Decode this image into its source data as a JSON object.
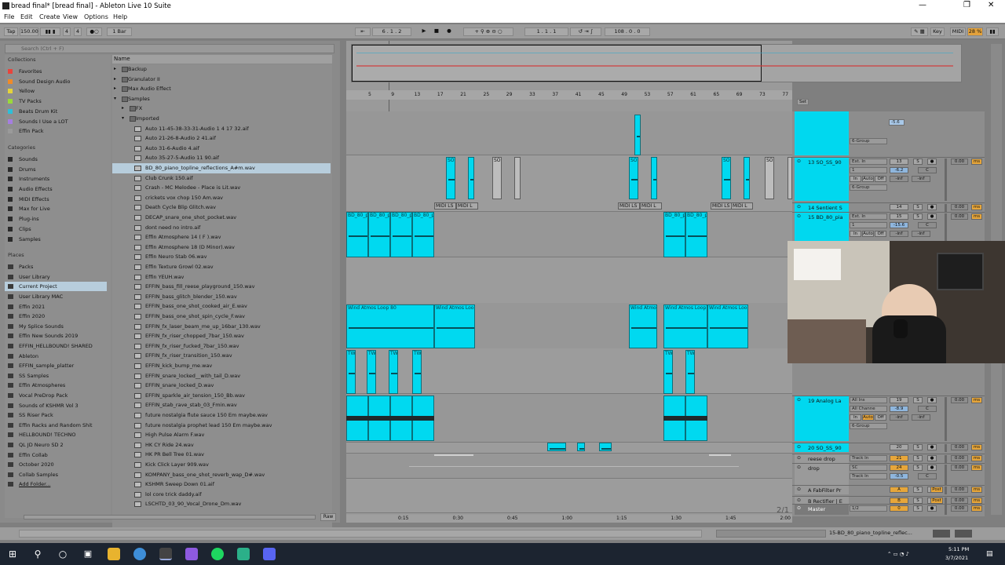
{
  "window": {
    "title": "bread final*  [bread final] - Ableton Live 10 Suite",
    "min": "—",
    "restore": "❐",
    "close": "✕"
  },
  "menu": [
    "File",
    "Edit",
    "Create",
    "View",
    "Options",
    "Help"
  ],
  "transport": {
    "tap": "Tap",
    "bpm": "150.00",
    "sig_num": "4",
    "sig_den": "4",
    "quant": "1 Bar",
    "position": "6 .  1 .  2",
    "loop_start": "1 .  1 .  1",
    "loop_len": "108 .  0 .  0",
    "key": "Key",
    "midi": "MIDI",
    "cpu": "28 %"
  },
  "browser": {
    "search_placeholder": "Search (Ctrl + F)",
    "collections_header": "Collections",
    "collections": [
      {
        "label": "Favorites",
        "color": "#e8453c"
      },
      {
        "label": "Sound Design Audio",
        "color": "#f08a28"
      },
      {
        "label": "Yellow",
        "color": "#e4d23b"
      },
      {
        "label": "TV Packs",
        "color": "#9ad93a"
      },
      {
        "label": "Beats Drum Kit",
        "color": "#2dbfd8"
      },
      {
        "label": "Sounds I Use a LOT",
        "color": "#a57ee0"
      },
      {
        "label": "Effin Pack",
        "color": "#9a9a9a"
      }
    ],
    "categories_header": "Categories",
    "categories": [
      "Sounds",
      "Drums",
      "Instruments",
      "Audio Effects",
      "MIDI Effects",
      "Max for Live",
      "Plug-ins",
      "Clips",
      "Samples"
    ],
    "places_header": "Places",
    "places": [
      "Packs",
      "User Library",
      "Current Project",
      "User Library MAC",
      "Effin 2021",
      "Effin 2020",
      "My Splice Sounds",
      "Effin New Sounds 2019",
      "EFFIN_HELLBOUND! SHARED",
      "Ableton",
      "EFFIN_sample_platter",
      "SS Samples",
      "Effin Atmospheres",
      "Vocal PreDrop Pack",
      "Sounds of KSHMR Vol 3",
      "SS Riser Pack",
      "Effin Racks and Random Shit",
      "HELLBOUND! TECHNO",
      "QL JD Neuro SD 2",
      "Effin Collab",
      "October 2020",
      "Collab Samples",
      "Add Folder..."
    ],
    "name_header": "Name",
    "files": [
      "Backup",
      "Granulator II",
      "Max Audio Effect",
      "Samples",
      "FX",
      "Imported",
      "Auto 11-45-38-33-31-Audio 1 4 17 32.aif",
      "Auto 21-26-8-Audio 2 41.aif",
      "Auto 31-6-Audio 4.aif",
      "Auto 35-27-5-Audio 11 90.aif",
      "BD_80_piano_topline_reflections_A#m.wav",
      "Club Crunk 150.aif",
      "Crash - MC Melodee - Place is Lit.wav",
      "crickets vox chop 150 Am.wav",
      "Death Cycle Blip Glitch.wav",
      "DECAP_snare_one_shot_pocket.wav",
      "dont need no intro.aif",
      "Effin Atmosphere 14 ( F ).wav",
      "Effin Atmosphere 18 (D Minor).wav",
      "Effin Neuro Stab 06.wav",
      "Effin Texture Growl 02.wav",
      "Effin YEUH.wav",
      "EFFIN_bass_fill_reese_playground_150.wav",
      "EFFIN_bass_glitch_blender_150.wav",
      "EFFIN_bass_one_shot_cooked_air_E.wav",
      "EFFIN_bass_one_shot_spin_cycle_F.wav",
      "EFFIN_fx_laser_beam_me_up_16bar_130.wav",
      "EFFIN_fx_riser_chopped_7bar_150.wav",
      "EFFIN_fx_riser_fucked_7bar_150.wav",
      "EFFIN_fx_riser_transition_150.wav",
      "EFFIN_kick_bump_me.wav",
      "EFFIN_snare_locked__with_tail_D.wav",
      "EFFIN_snare_locked_D.wav",
      "EFFIN_sparkle_air_tension_150_Bb.wav",
      "EFFIN_stab_rave_stab_03_Fmin.wav",
      "future nostalgia flute sauce 150 Em maybe.wav",
      "future nostalgia prophet lead 150 Em maybe.wav",
      "High Pulse Alarm F.wav",
      "HK CY Ride 24.wav",
      "HK PR Bell Tree 01.wav",
      "Kick Click Layer 909.wav",
      "KOMPANY_bass_one_shot_reverb_wap_D#.wav",
      "KSHMR Sweep Down 01.aif",
      "lol core trick daddy.aif",
      "LSCHTD_03_90_Vocal_Drone_Dm.wav"
    ],
    "raw": "Raw"
  },
  "ruler": [
    "5",
    "9",
    "13",
    "17",
    "21",
    "25",
    "29",
    "33",
    "37",
    "41",
    "45",
    "49",
    "53",
    "57",
    "61",
    "65",
    "69",
    "73",
    "77"
  ],
  "timeline": [
    "0:15",
    "0:30",
    "0:45",
    "1:00",
    "1:15",
    "1:30",
    "1:45",
    "2:00"
  ],
  "set_label": "Set",
  "clips": {
    "so": "SO",
    "bd": "BD_80_p",
    "wind": "Wind Atmos Loop 80",
    "wind2": "Wind Atmos Loo",
    "wind3": "Wind Atmos",
    "wind4": "Wind Atmos Loop",
    "wind5": "Wind Atmos Loo",
    "midi": "MIDI LS",
    "midi2": "MIDI L",
    "tw": "TWI"
  },
  "mixer": {
    "rows": [
      {
        "name": "13 SO_SS_90",
        "input": "Ext. In",
        "chan": "1",
        "mon1": "In",
        "mon2": "Auto",
        "mon3": "Off",
        "out": "6-Group",
        "num": "13",
        "vol": "-6.2",
        "pan": "C",
        "sends": "-inf",
        "dB": "0.00",
        "ms": "ms"
      },
      {
        "name": "14 Sentient S",
        "num": "14",
        "dB": "0.00",
        "ms": "ms"
      },
      {
        "name": "15 BD_80_pia",
        "input": "Ext. In",
        "chan": "1",
        "mon1": "In",
        "mon2": "Auto",
        "mon3": "Off",
        "num": "15",
        "vol": "-15.6",
        "pan": "C",
        "sends": "-inf",
        "dB": "0.00",
        "ms": "ms"
      },
      {
        "name": "19 Analog La",
        "input": "All Ins",
        "chan": "All Channe",
        "mon1": "In",
        "mon2": "Auto",
        "mon3": "Off",
        "out": "6-Group",
        "num": "19",
        "vol": "-8.9",
        "pan": "C",
        "sends": "-inf",
        "dB": "0.00",
        "ms": "ms"
      },
      {
        "name": "20 SO_SS_90",
        "num": "20",
        "dB": "0.00",
        "ms": "ms"
      },
      {
        "name": "reese drop",
        "input": "Track In",
        "num": "21",
        "dB": "0.00",
        "ms": "ms"
      },
      {
        "name": "drop",
        "input": "SC",
        "input2": "Track In",
        "num": "24",
        "vol": "-0.5",
        "pan": "C",
        "dB": "0.00",
        "ms": "ms"
      },
      {
        "name": "A FabFilter Pr",
        "num": "A",
        "post": "Post",
        "dB": "0.00",
        "ms": "ms"
      },
      {
        "name": "B Rectifier | E",
        "num": "B",
        "post": "Post",
        "dB": "0.00",
        "ms": "ms"
      },
      {
        "name": "Master",
        "input": "1/2",
        "num": "0",
        "dB": "0.00",
        "ms": "ms"
      }
    ],
    "top_vol": "-5.6",
    "top_pan": "C",
    "top_sends": "-inf",
    "top_group": "6-Group",
    "page": "2/1"
  },
  "status": {
    "clip_name": "15-BD_80_piano_topline_reflec..."
  },
  "taskbar": {
    "time": "5:11 PM",
    "date": "3/7/2021"
  }
}
